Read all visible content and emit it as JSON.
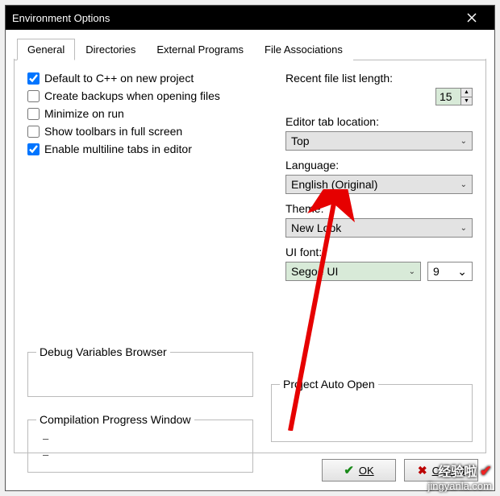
{
  "window": {
    "title": "Environment Options"
  },
  "tabs": [
    "General",
    "Directories",
    "External Programs",
    "File Associations"
  ],
  "activeTab": 0,
  "checks": {
    "default_cpp": {
      "label": "Default to C++ on new project",
      "checked": true
    },
    "create_backups": {
      "label": "Create backups when opening files",
      "checked": false
    },
    "minimize_run": {
      "label": "Minimize on run",
      "checked": false
    },
    "toolbars_fullscreen": {
      "label": "Show toolbars in full screen",
      "checked": false
    },
    "multiline_tabs": {
      "label": "Enable multiline tabs in editor",
      "checked": true
    }
  },
  "right": {
    "recent_label": "Recent file list length:",
    "recent_value": "15",
    "editor_tab_label": "Editor tab location:",
    "editor_tab_value": "Top",
    "language_label": "Language:",
    "language_value": "English (Original)",
    "theme_label": "Theme:",
    "theme_value": "New Look",
    "uifont_label": "UI font:",
    "uifont_value": "Segoe UI",
    "uifont_size": "9"
  },
  "groups": {
    "debug": "Debug Variables Browser",
    "comp": "Compilation Progress Window",
    "proj": "Project Auto Open",
    "dash": "–"
  },
  "buttons": {
    "ok": "OK",
    "cancel": "Cancel"
  },
  "watermark": {
    "line1": "经验啦",
    "check": "✔",
    "line2": "jingyanla.com"
  }
}
